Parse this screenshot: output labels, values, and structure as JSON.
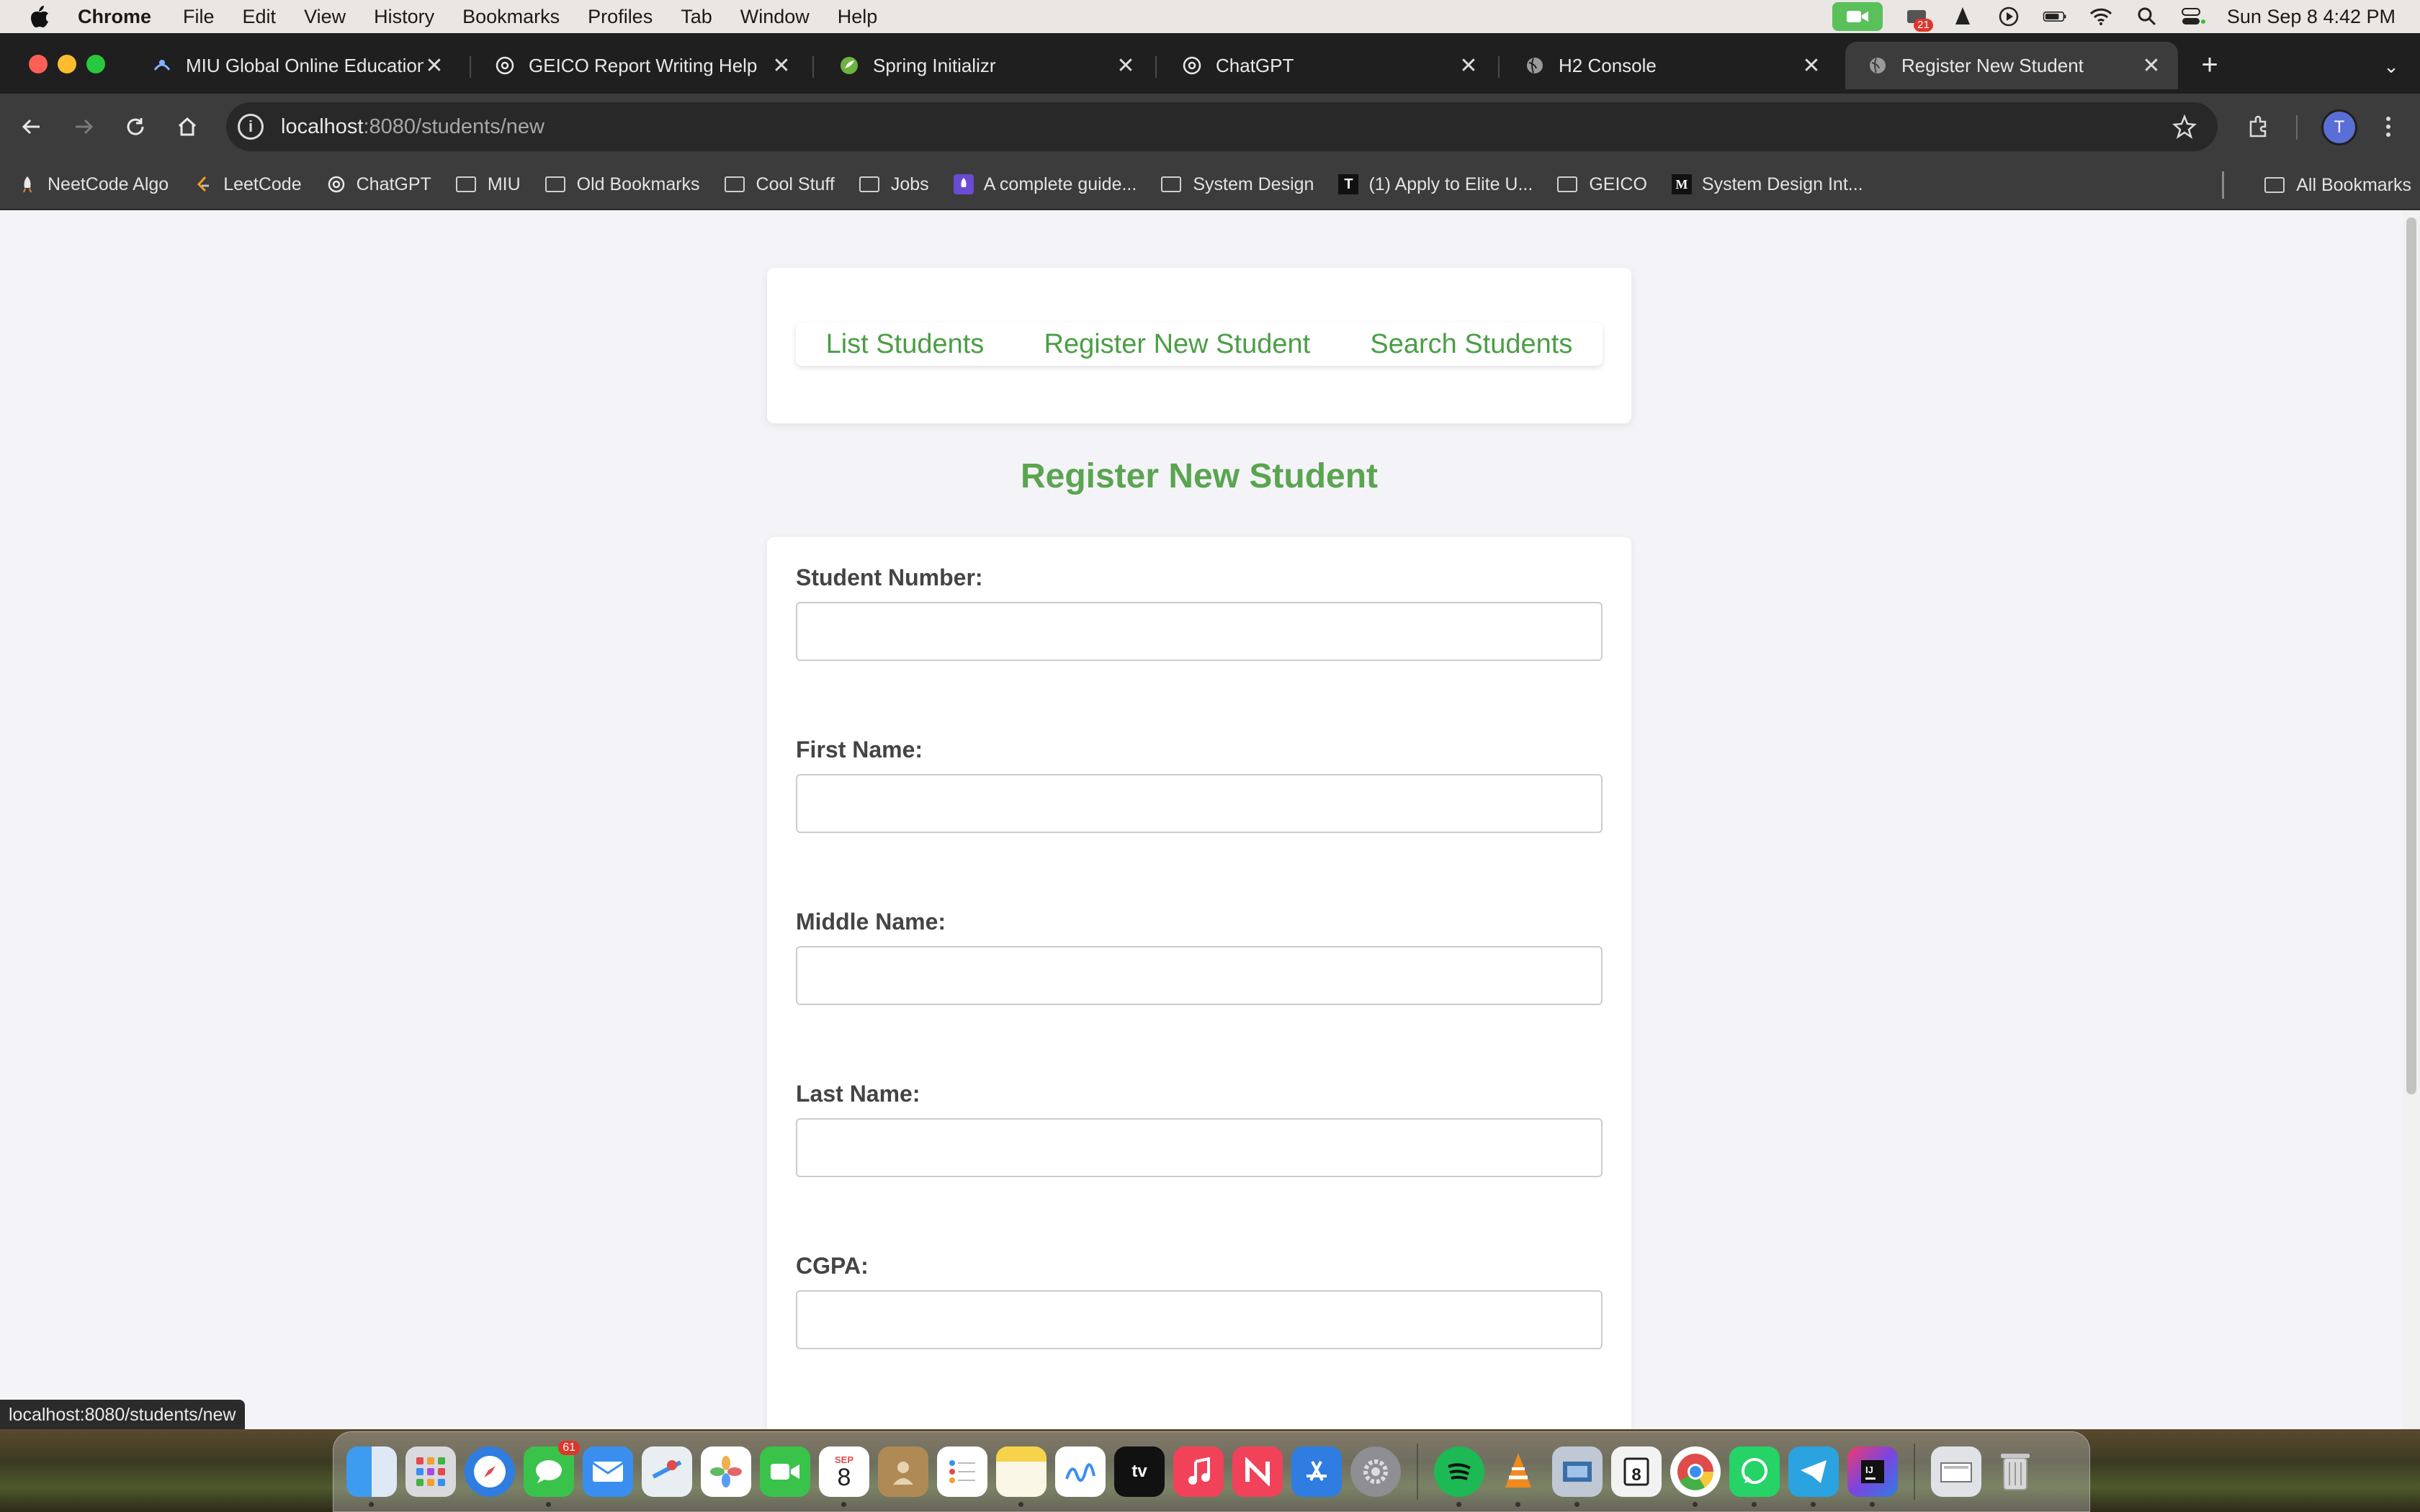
{
  "menubar": {
    "app": "Chrome",
    "items": [
      "File",
      "Edit",
      "View",
      "History",
      "Bookmarks",
      "Profiles",
      "Tab",
      "Window",
      "Help"
    ],
    "clock": "Sun Sep 8  4:42 PM",
    "notification_count": "21"
  },
  "tabs": [
    {
      "title": "MIU Global Online Education",
      "icon": "miu-icon"
    },
    {
      "title": "GEICO Report Writing Help",
      "icon": "chatgpt-icon"
    },
    {
      "title": "Spring Initializr",
      "icon": "spring-icon"
    },
    {
      "title": "ChatGPT",
      "icon": "chatgpt-icon"
    },
    {
      "title": "H2 Console",
      "icon": "globe-icon"
    },
    {
      "title": "Register New Student",
      "icon": "globe-icon"
    }
  ],
  "toolbar": {
    "url_host": "localhost",
    "url_path": ":8080/students/new",
    "profile_initial": "T"
  },
  "bookmarks": [
    {
      "label": "NeetCode Algo",
      "type": "site",
      "icon": "rocket-icon"
    },
    {
      "label": "LeetCode",
      "type": "site",
      "icon": "leetcode-icon"
    },
    {
      "label": "ChatGPT",
      "type": "site",
      "icon": "chatgpt-icon"
    },
    {
      "label": "MIU",
      "type": "folder"
    },
    {
      "label": "Old Bookmarks",
      "type": "folder"
    },
    {
      "label": "Cool Stuff",
      "type": "folder"
    },
    {
      "label": "Jobs",
      "type": "folder"
    },
    {
      "label": "A complete guide...",
      "type": "site",
      "icon": "rocket-icon"
    },
    {
      "label": "System Design",
      "type": "folder"
    },
    {
      "label": "(1) Apply to Elite U...",
      "type": "site",
      "icon": "elite-icon"
    },
    {
      "label": "GEICO",
      "type": "folder"
    },
    {
      "label": "System Design Int...",
      "type": "site",
      "icon": "medium-icon"
    }
  ],
  "bookmarks_all": "All Bookmarks",
  "page": {
    "nav": {
      "list": "List Students",
      "register": "Register New Student",
      "search": "Search Students"
    },
    "heading": "Register New Student",
    "fields": [
      {
        "label": "Student Number:",
        "value": ""
      },
      {
        "label": "First Name:",
        "value": ""
      },
      {
        "label": "Middle Name:",
        "value": ""
      },
      {
        "label": "Last Name:",
        "value": ""
      },
      {
        "label": "CGPA:",
        "value": ""
      }
    ],
    "accent_color": "#4a9e44"
  },
  "status_bar_url": "localhost:8080/students/new",
  "dock": {
    "messages_badge": "61",
    "calendar_month": "SEP",
    "calendar_day": "8"
  }
}
